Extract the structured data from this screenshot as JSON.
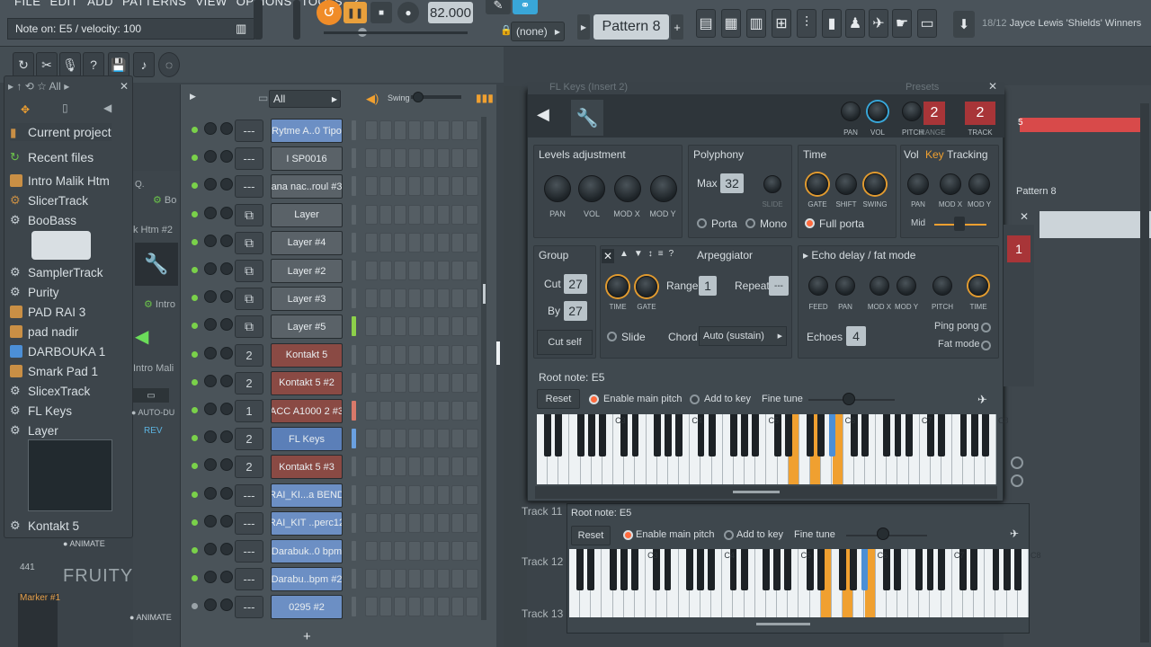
{
  "menu": [
    "FILE",
    "EDIT",
    "ADD",
    "PATTERNS",
    "VIEW",
    "OPTIONS",
    "TOOLS",
    "?"
  ],
  "hint": "Note on: E5 / velocity: 100",
  "tempo": "82.000",
  "pattern": "Pattern 8",
  "none_label": "(none)",
  "news": {
    "num": "18/12",
    "text": "Jayce Lewis 'Shields' Winners"
  },
  "browser": {
    "filter": "All",
    "items": [
      {
        "label": "Current project",
        "icon": "folder-icon",
        "color": "#c98f45"
      },
      {
        "label": "Recent files",
        "icon": "recent-icon",
        "color": "#6bc34a"
      },
      {
        "label": "Intro Malik Htm",
        "icon": "audio-clip-icon",
        "color": "#c98f45"
      },
      {
        "label": "SlicerTrack",
        "icon": "gear-icon",
        "color": "#c98f45"
      },
      {
        "label": "BooBass",
        "icon": "gear-icon",
        "color": "#c8d0d6"
      },
      {
        "label": "SamplerTrack",
        "icon": "gear-icon",
        "color": "#c8d0d6"
      },
      {
        "label": "Purity",
        "icon": "gear-icon",
        "color": "#c8d0d6"
      },
      {
        "label": "PAD RAI 3",
        "icon": "audio-clip-icon",
        "color": "#c98f45"
      },
      {
        "label": "pad nadir",
        "icon": "audio-clip-icon",
        "color": "#c98f45"
      },
      {
        "label": "DARBOUKA 1",
        "icon": "audio-clip-icon",
        "color": "#4c8fd6"
      },
      {
        "label": "Smark Pad 1",
        "icon": "mp3-icon",
        "color": "#c98f45"
      },
      {
        "label": "SlicexTrack",
        "icon": "gear-icon",
        "color": "#c8d0d6"
      },
      {
        "label": "FL Keys",
        "icon": "gear-icon",
        "color": "#c8d0d6"
      },
      {
        "label": "Layer",
        "icon": "gear-icon",
        "color": "#c8d0d6"
      },
      {
        "label": "Kontakt 5",
        "icon": "gear-icon",
        "color": "#c8d0d6"
      }
    ]
  },
  "rack": {
    "filter": "All",
    "swing": "Swing",
    "channels": [
      {
        "name": "Rytme A..0 Tipo",
        "mixer": "---",
        "color": "#6c8fc4"
      },
      {
        "name": "I SP0016",
        "mixer": "---",
        "color": "#5a6268"
      },
      {
        "name": "ana nac..roul #3",
        "mixer": "---",
        "color": "#5a6268"
      },
      {
        "name": "Layer",
        "mixer": "layer",
        "color": "#5a6268"
      },
      {
        "name": "Layer #4",
        "mixer": "layer",
        "color": "#5a6268"
      },
      {
        "name": "Layer #2",
        "mixer": "layer",
        "color": "#5a6268"
      },
      {
        "name": "Layer #3",
        "mixer": "layer",
        "color": "#5a6268"
      },
      {
        "name": "Layer #5",
        "mixer": "layer",
        "color": "#5a6268"
      },
      {
        "name": "Kontakt 5",
        "mixer": "2",
        "color": "#8a4a44"
      },
      {
        "name": "Kontakt 5 #2",
        "mixer": "2",
        "color": "#8a4a44"
      },
      {
        "name": "ACC A1000 2 #3",
        "mixer": "1",
        "color": "#8a4a44"
      },
      {
        "name": "FL Keys",
        "mixer": "2",
        "color": "#5b7fb8"
      },
      {
        "name": "Kontakt 5 #3",
        "mixer": "2",
        "color": "#8a4a44"
      },
      {
        "name": "RAI_KI...a BEND",
        "mixer": "---",
        "color": "#6c8fc4"
      },
      {
        "name": "RAI_KIT ..perc12",
        "mixer": "---",
        "color": "#6c8fc4"
      },
      {
        "name": "Darabuk..0 bpm",
        "mixer": "---",
        "color": "#6c8fc4"
      },
      {
        "name": "Darabu..bpm #2",
        "mixer": "---",
        "color": "#6c8fc4"
      },
      {
        "name": "0295 #2",
        "mixer": "---",
        "color": "#6c8fc4"
      }
    ],
    "add": "+"
  },
  "plugin": {
    "title": "FL Keys (Insert 2)",
    "presets": "Presets",
    "header": {
      "pan": "PAN",
      "vol": "VOL",
      "pitch": "PITCH",
      "range": "RANGE",
      "track": "TRACK",
      "range_val": "2",
      "track_val": "2"
    },
    "levels": {
      "title": "Levels adjustment",
      "knobs": [
        "PAN",
        "VOL",
        "MOD X",
        "MOD Y"
      ]
    },
    "poly": {
      "title": "Polyphony",
      "max_label": "Max",
      "max_val": "32",
      "slide": "SLIDE",
      "porta": "Porta",
      "mono": "Mono"
    },
    "time": {
      "title": "Time",
      "knobs": [
        "GATE",
        "SHIFT",
        "SWING"
      ],
      "full_porta": "Full porta"
    },
    "tracking": {
      "vol": "Vol",
      "key": "Key",
      "title": "Tracking",
      "knobs": [
        "PAN",
        "MOD X",
        "MOD Y"
      ],
      "mid": "Mid"
    },
    "group": {
      "title": "Group",
      "cut": "Cut",
      "cut_val": "27",
      "by": "By",
      "by_val": "27",
      "cut_self": "Cut self"
    },
    "arp": {
      "title": "Arpeggiator",
      "knobs": [
        "TIME",
        "GATE"
      ],
      "range": "Range",
      "range_val": "1",
      "repeat": "Repeat",
      "repeat_val": "---",
      "slide": "Slide",
      "chord": "Chord",
      "chord_val": "Auto (sustain)"
    },
    "echo": {
      "title": "Echo delay / fat mode",
      "knobs": [
        "FEED",
        "PAN",
        "MOD X",
        "MOD Y",
        "PITCH",
        "TIME"
      ],
      "echoes": "Echoes",
      "echoes_val": "4",
      "ping": "Ping pong",
      "fat": "Fat mode"
    },
    "root": {
      "title": "Root note: E5",
      "reset": "Reset",
      "main_pitch": "Enable main pitch",
      "add_key": "Add to key",
      "fine": "Fine tune",
      "octaves": [
        "C3",
        "C4",
        "C5",
        "C6",
        "C7",
        "C8"
      ]
    }
  },
  "plugin2": {
    "title": "Root note: E5",
    "reset": "Reset",
    "main_pitch": "Enable main pitch",
    "add_key": "Add to key",
    "fine": "Fine tune",
    "octaves": [
      "C3",
      "C4",
      "C5",
      "C6",
      "C7",
      "C8"
    ]
  },
  "playlist": {
    "tracks": [
      "Track 11",
      "Track 12",
      "Track 13"
    ],
    "pattern": "Pattern 8",
    "marker": "5"
  },
  "side": {
    "intro": "Intro Mali",
    "fruity": "FRUITY",
    "animate": "ANIMATE",
    "auto": "AUTO-DU",
    "rev": "REV",
    "marker": "Marker #1",
    "num": "441",
    "htm": "k Htm #2",
    "intro2": "Intro",
    "bo": "Bo"
  },
  "colors": {
    "orange": "#f0a030",
    "accent_blue": "#38a7d9",
    "red": "#b03a3a"
  }
}
